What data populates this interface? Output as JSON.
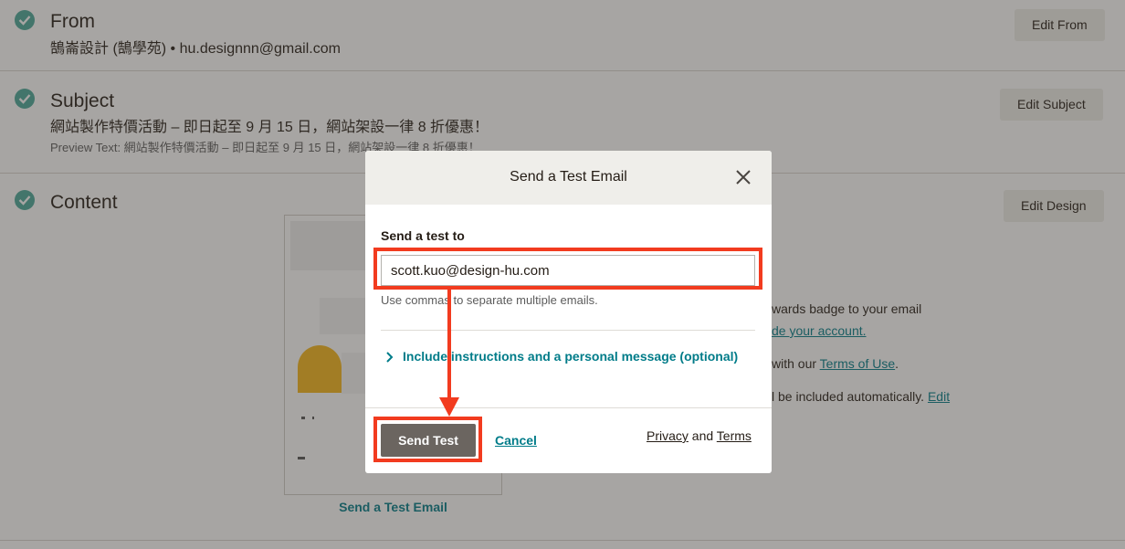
{
  "from": {
    "title": "From",
    "value": "鵠崙設計 (鵠學苑) • hu.designnn@gmail.com",
    "edit_label": "Edit From"
  },
  "subject": {
    "title": "Subject",
    "value": "網站製作特價活動 – 即日起至 9 月 15 日，網站架設一律 8 折優惠！",
    "preview_text": "Preview Text: 網站製作特價活動 – 即日起至 9 月 15 日，網站架設一律 8 折優惠！",
    "edit_label": "Edit Subject"
  },
  "content": {
    "title": "Content",
    "edit_label": "Edit Design",
    "preview_link": "Send a Test Email",
    "side_line1": "wards badge to your email",
    "side_line2_link": "de your account.",
    "side_line3_prefix": "with our ",
    "side_line3_link": "Terms of Use",
    "side_line3_suffix": ".",
    "side_line4_prefix": "l be included automatically. ",
    "side_line4_link": "Edit"
  },
  "modal": {
    "title": "Send a Test Email",
    "field_label": "Send a test to",
    "email_value": "scott.kuo@design-hu.com",
    "hint": "Use commas to separate multiple emails.",
    "include_link": "Include instructions and a personal message (optional)",
    "send_label": "Send Test",
    "cancel_label": "Cancel",
    "privacy": "Privacy",
    "and": " and ",
    "terms": "Terms"
  },
  "colors": {
    "accent": "#007c89",
    "check": "#4aa89a",
    "annotation": "#f23b1f",
    "send_button": "#6b6560"
  }
}
